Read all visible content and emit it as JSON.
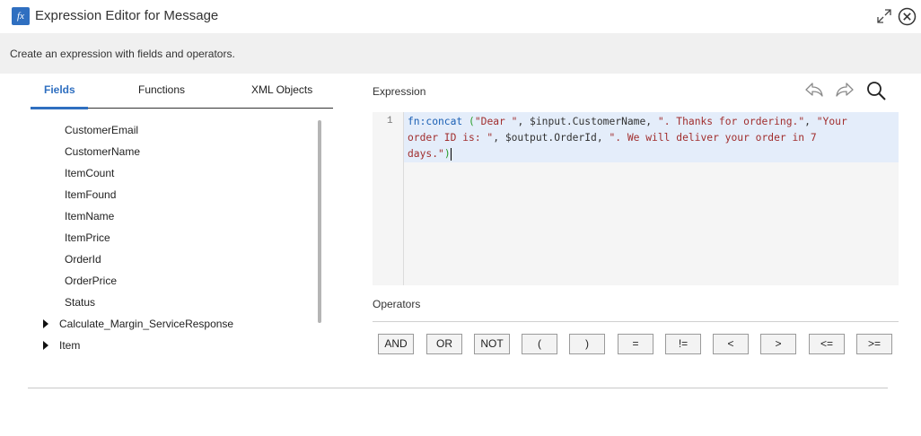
{
  "window": {
    "title": "Expression Editor for Message",
    "title_icon_text": "fx"
  },
  "banner": {
    "text": "Create an expression with fields and operators."
  },
  "tabs": [
    {
      "label": "Fields",
      "active": true
    },
    {
      "label": "Functions",
      "active": false
    },
    {
      "label": "XML Objects",
      "active": false
    }
  ],
  "fields": [
    {
      "label": "CustomerEmail"
    },
    {
      "label": "CustomerName"
    },
    {
      "label": "ItemCount"
    },
    {
      "label": "ItemFound"
    },
    {
      "label": "ItemName"
    },
    {
      "label": "ItemPrice"
    },
    {
      "label": "OrderId"
    },
    {
      "label": "OrderPrice"
    },
    {
      "label": "Status"
    },
    {
      "label": "Calculate_Margin_ServiceResponse",
      "expandable": true
    },
    {
      "label": "Item",
      "expandable": true
    }
  ],
  "expression": {
    "label": "Expression",
    "line_number": "1",
    "code_lines": [
      "fn:concat (\"Dear \", $input.CustomerName, \". Thanks for ordering.\", \"Your",
      "order ID is: \", $output.OrderId, \". We will deliver your order in 7",
      "days.\")"
    ]
  },
  "toolbar": {
    "undo_icon": "undo-icon",
    "redo_icon": "redo-icon",
    "search_icon": "search-icon"
  },
  "operators": {
    "label": "Operators",
    "buttons": [
      "AND",
      "OR",
      "NOT",
      "(",
      ")",
      "=",
      "!=",
      "<",
      ">",
      "<=",
      ">="
    ]
  },
  "colors": {
    "accent": "#2f6fc0",
    "string": "#a12e2e",
    "function": "#1a5fb4",
    "selection": "#e4edfa"
  }
}
